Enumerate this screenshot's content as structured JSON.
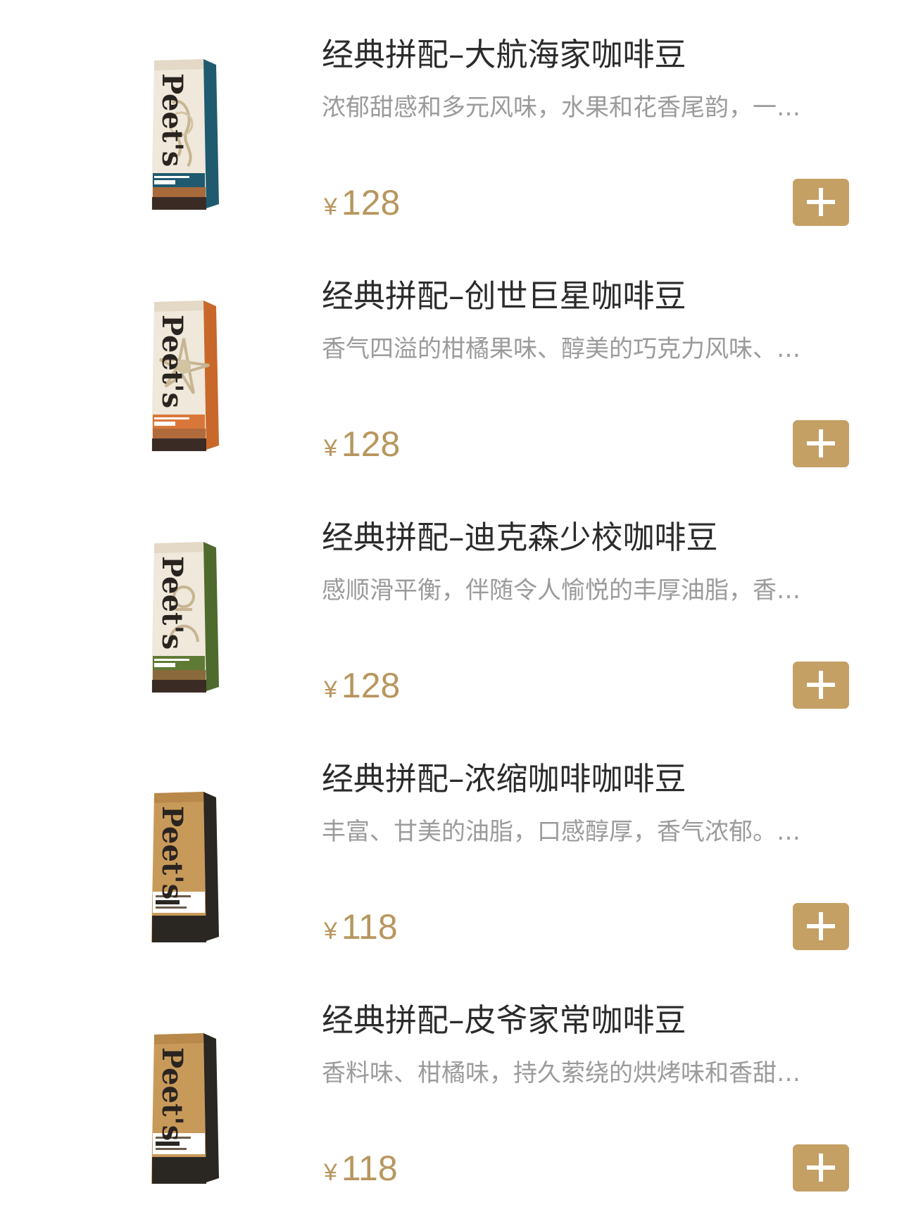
{
  "currency_symbol": "¥",
  "brand_logo_text": "Peet's",
  "products": [
    {
      "name": "经典拼配–大航海家咖啡豆",
      "description": "浓郁甜感和多元风味，水果和花香尾韵，一…",
      "price": "128",
      "package_label": "大航海家",
      "package_style": "illustrated",
      "accent_color": "#1f5a6e"
    },
    {
      "name": "经典拼配–创世巨星咖啡豆",
      "description": "香气四溢的柑橘果味、醇美的巧克力风味、…",
      "price": "128",
      "package_label": "创世巨星",
      "package_style": "illustrated",
      "accent_color": "#c8682a"
    },
    {
      "name": "经典拼配–迪克森少校咖啡豆",
      "description": "感顺滑平衡，伴随令人愉悦的丰厚油脂，香…",
      "price": "128",
      "package_label": "迪克森少校",
      "package_style": "illustrated",
      "accent_color": "#4e6a2c"
    },
    {
      "name": "经典拼配–浓缩咖啡咖啡豆",
      "description": "丰富、甘美的油脂，口感醇厚，香气浓郁。…",
      "price": "118",
      "package_label": "浓缩咖啡",
      "package_style": "kraft",
      "accent_color": "#c89a5a"
    },
    {
      "name": "经典拼配–皮爷家常咖啡豆",
      "description": "香料味、柑橘味，持久萦绕的烘烤味和香甜…",
      "price": "118",
      "package_label": "皮爷家常",
      "package_style": "kraft",
      "accent_color": "#c89a5a"
    }
  ],
  "add_button_icon": "plus-icon",
  "colors": {
    "price": "#b8965e",
    "add_button": "#c4a065",
    "title_text": "#2b2b2b",
    "description_text": "#9b9b9b"
  }
}
